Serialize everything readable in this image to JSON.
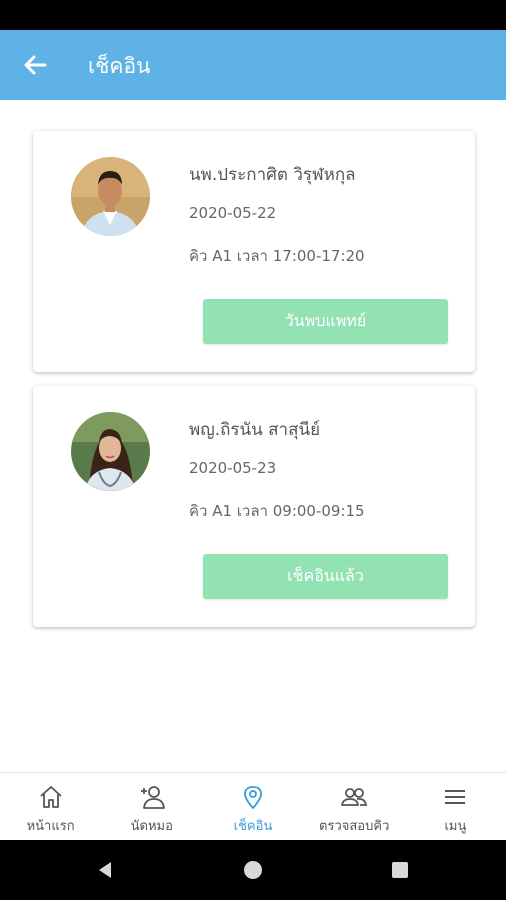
{
  "app_bar": {
    "title": "เช็คอิน",
    "back_icon": "arrow-left-icon",
    "color": "#5fb2e5"
  },
  "appointments": [
    {
      "doctor_name": "นพ.ประกาศิต วิรุฬหกุล",
      "date": "2020-05-22",
      "queue": "คิว A1 เวลา 17:00-17:20",
      "button_label": "วันพบแพทย์"
    },
    {
      "doctor_name": "พญ.ถิรนัน สาสุนีย์",
      "date": "2020-05-23",
      "queue": "คิว A1 เวลา 09:00-09:15",
      "button_label": "เช็คอินแล้ว"
    }
  ],
  "colors": {
    "button": "#93e2b4",
    "active_nav": "#3a9ad9"
  },
  "bottom_nav": {
    "items": [
      {
        "label": "หน้าแรก",
        "icon": "home-icon",
        "active": false
      },
      {
        "label": "นัดหมอ",
        "icon": "add-person-icon",
        "active": false
      },
      {
        "label": "เช็คอิน",
        "icon": "location-pin-icon",
        "active": true
      },
      {
        "label": "ตรวจสอบคิว",
        "icon": "people-icon",
        "active": false
      },
      {
        "label": "เมนู",
        "icon": "menu-icon",
        "active": false
      }
    ]
  },
  "system_nav": {
    "icons": [
      "back-triangle-icon",
      "home-circle-icon",
      "recents-square-icon"
    ]
  }
}
